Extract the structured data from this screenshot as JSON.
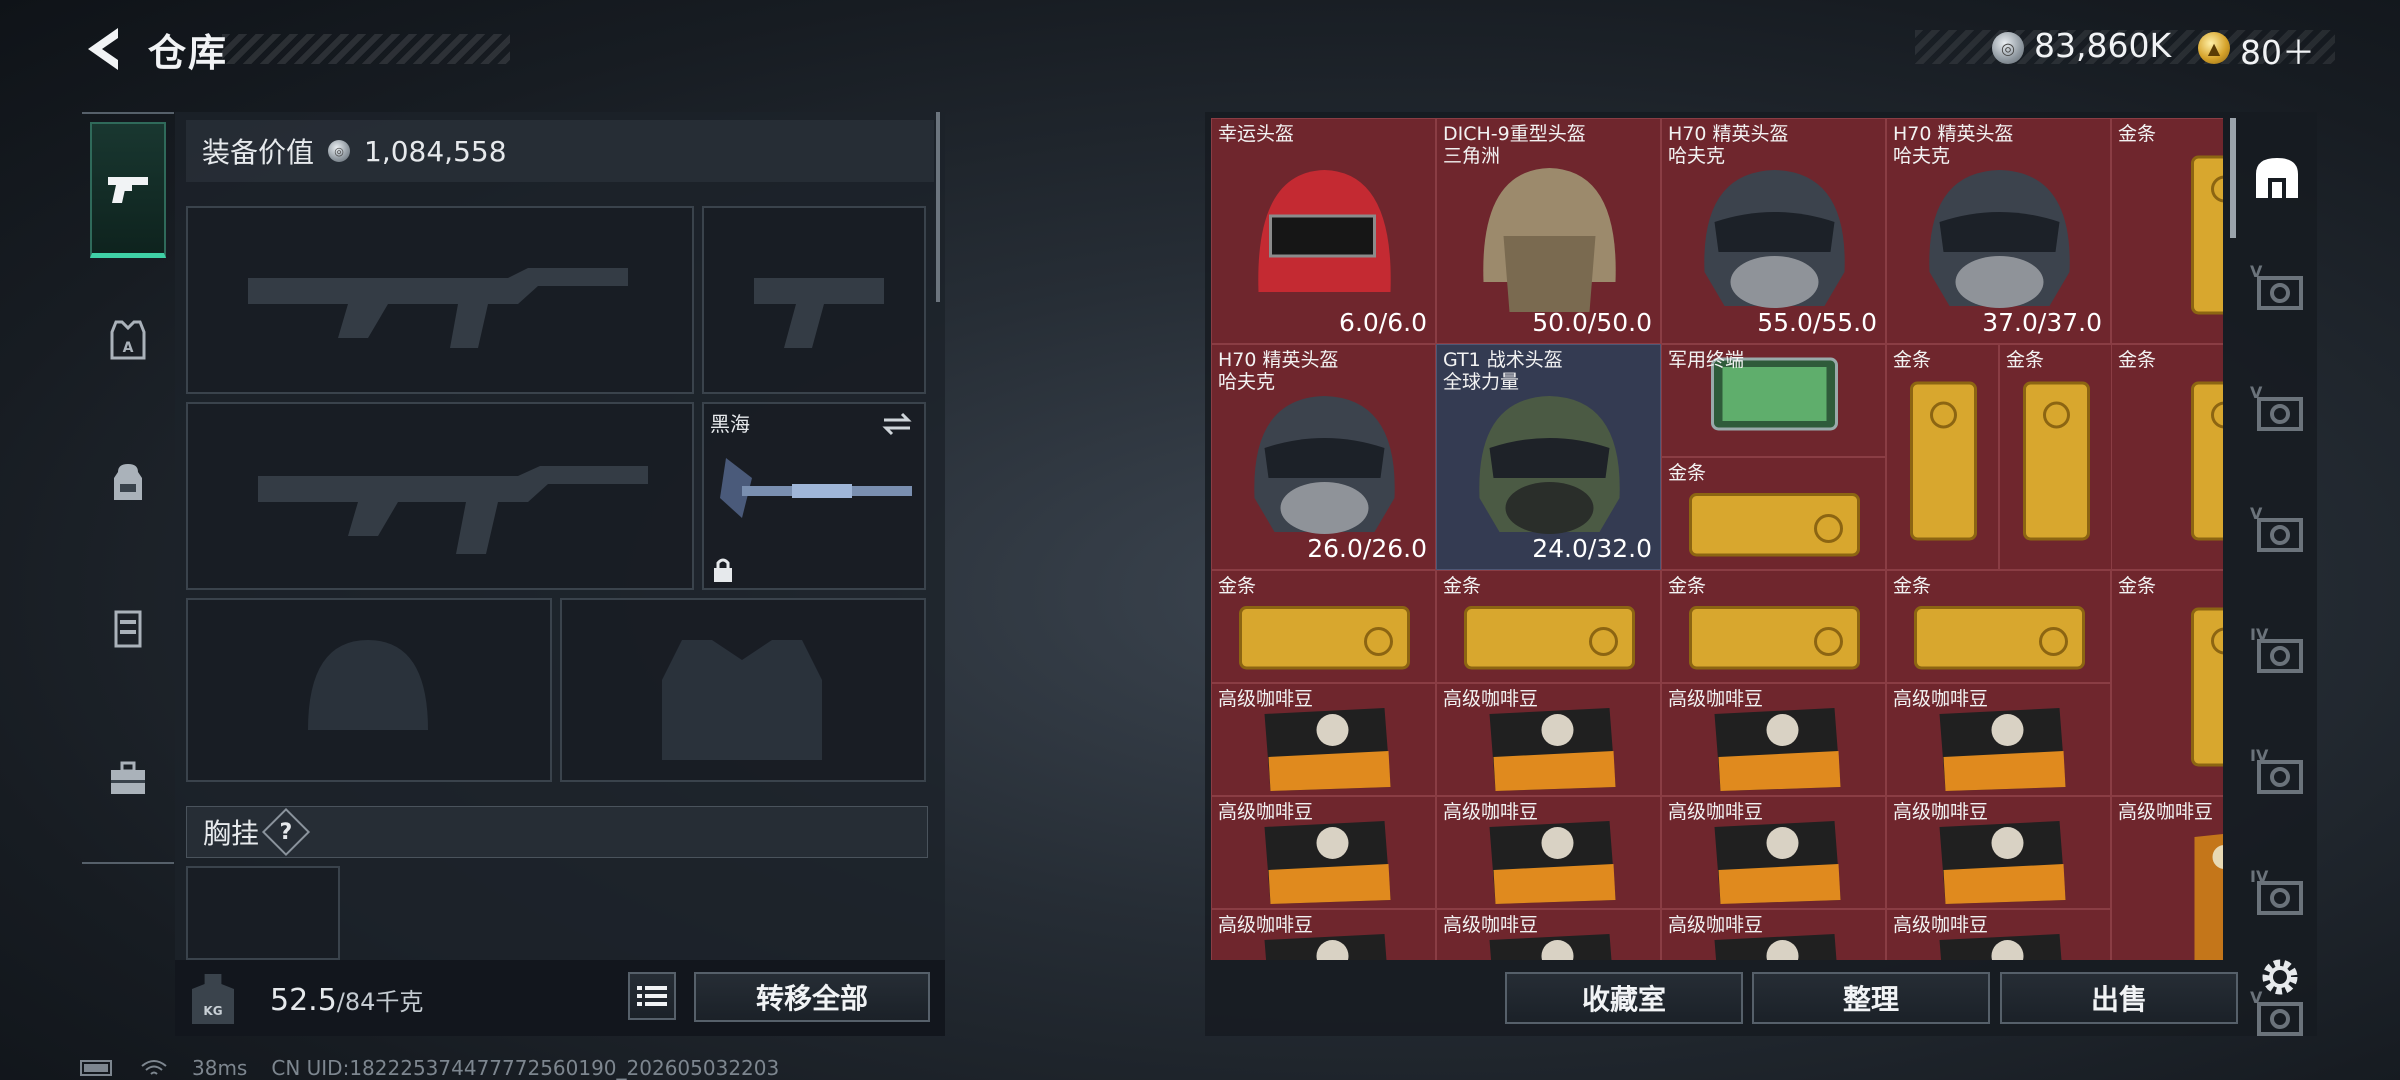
{
  "header": {
    "title": "仓库",
    "currency_silver": "83,860K",
    "currency_gold": "80＋"
  },
  "loadout": {
    "value_label": "装备价值",
    "value": "1,084,558",
    "melee_label": "黑海",
    "chest_label": "胸挂",
    "chest_help": "?",
    "weight_current": "52.5",
    "weight_max": "/84千克",
    "weight_icon_text": "KG",
    "transfer_all": "转移全部"
  },
  "tabs": [
    "weapons-tab",
    "armor-tab",
    "backpack-tab",
    "rig-tab",
    "case-tab"
  ],
  "inventory": {
    "items": [
      {
        "name": "幸运头盔",
        "sub": "",
        "dur": "6.0/6.0",
        "type": "helmet-red"
      },
      {
        "name": "DICH-9重型头盔",
        "sub": "三角洲",
        "dur": "50.0/50.0",
        "type": "helmet-tan"
      },
      {
        "name": "H70 精英头盔",
        "sub": "哈夫克",
        "dur": "55.0/55.0",
        "type": "helmet-dark"
      },
      {
        "name": "H70 精英头盔",
        "sub": "哈夫克",
        "dur": "37.0/37.0",
        "type": "helmet-dark"
      },
      {
        "name": "金条",
        "sub": "",
        "dur": "",
        "type": "gold-v"
      },
      {
        "name": "H70 精英头盔",
        "sub": "哈夫克",
        "dur": "26.0/26.0",
        "type": "helmet-dark"
      },
      {
        "name": "GT1 战术头盔",
        "sub": "全球力量",
        "dur": "24.0/32.0",
        "type": "helmet-green"
      },
      {
        "name": "军用终端",
        "sub": "",
        "dur": "",
        "type": "terminal"
      },
      {
        "name": "金条",
        "sub": "",
        "dur": "",
        "type": "gold-h"
      },
      {
        "name": "金条",
        "sub": "",
        "dur": "",
        "type": "gold-v"
      },
      {
        "name": "金条",
        "sub": "",
        "dur": "",
        "type": "gold-v"
      },
      {
        "name": "金条",
        "sub": "",
        "dur": "",
        "type": "gold-v"
      },
      {
        "name": "金条",
        "sub": "",
        "dur": "",
        "type": "gold-h"
      },
      {
        "name": "金条",
        "sub": "",
        "dur": "",
        "type": "gold-h"
      },
      {
        "name": "金条",
        "sub": "",
        "dur": "",
        "type": "gold-h"
      },
      {
        "name": "金条",
        "sub": "",
        "dur": "",
        "type": "gold-h"
      },
      {
        "name": "金条",
        "sub": "",
        "dur": "",
        "type": "gold-v"
      },
      {
        "name": "高级咖啡豆",
        "sub": "",
        "dur": "",
        "type": "coffee"
      },
      {
        "name": "高级咖啡豆",
        "sub": "",
        "dur": "",
        "type": "coffee"
      },
      {
        "name": "高级咖啡豆",
        "sub": "",
        "dur": "",
        "type": "coffee"
      },
      {
        "name": "高级咖啡豆",
        "sub": "",
        "dur": "",
        "type": "coffee"
      },
      {
        "name": "高级咖啡豆",
        "sub": "",
        "dur": "",
        "type": "coffee"
      },
      {
        "name": "高级咖啡豆",
        "sub": "",
        "dur": "",
        "type": "coffee"
      },
      {
        "name": "高级咖啡豆",
        "sub": "",
        "dur": "",
        "type": "coffee"
      },
      {
        "name": "高级咖啡豆",
        "sub": "",
        "dur": "",
        "type": "coffee"
      },
      {
        "name": "高级咖啡豆",
        "sub": "",
        "dur": "",
        "type": "coffee-v"
      },
      {
        "name": "高级咖啡豆",
        "sub": "",
        "dur": "",
        "type": "coffee"
      },
      {
        "name": "高级咖啡豆",
        "sub": "",
        "dur": "",
        "type": "coffee"
      },
      {
        "name": "高级咖啡豆",
        "sub": "",
        "dur": "",
        "type": "coffee"
      },
      {
        "name": "高级咖啡豆",
        "sub": "",
        "dur": "",
        "type": "coffee"
      }
    ],
    "buttons": {
      "collection": "收藏室",
      "organize": "整理",
      "sell": "出售"
    },
    "rail_levels": [
      "V",
      "V",
      "V",
      "IV",
      "IV",
      "IV",
      "V"
    ]
  },
  "footer": {
    "ping": "38ms",
    "uid": "CN UID:182225374477772560190_202605032203"
  }
}
